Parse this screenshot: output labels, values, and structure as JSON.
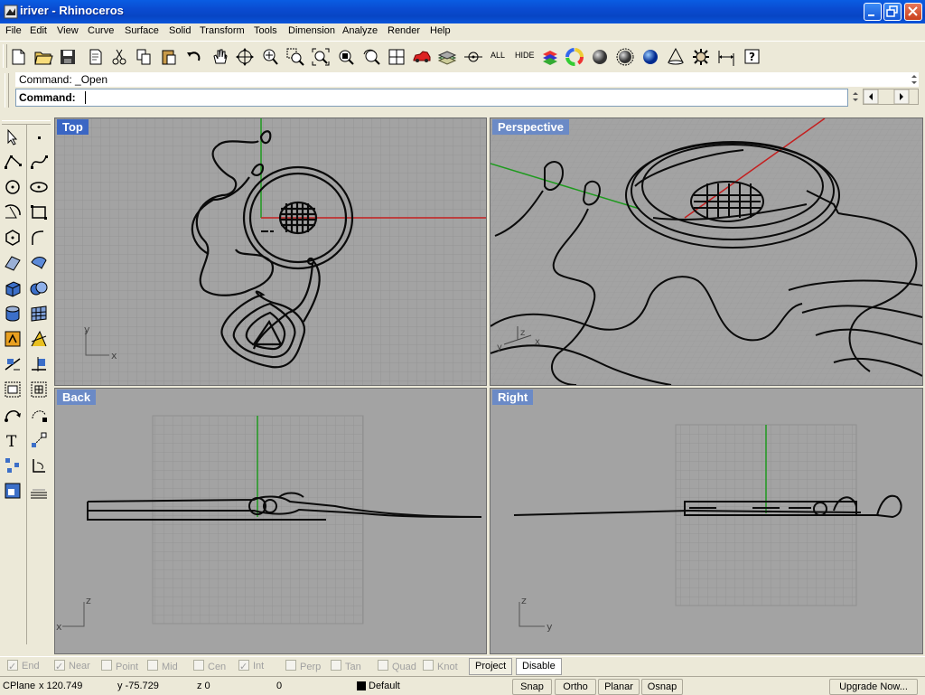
{
  "window": {
    "title": "iriver - Rhinoceros",
    "controls": [
      "minimize-icon",
      "restore-icon",
      "close-icon"
    ]
  },
  "menu": [
    "File",
    "Edit",
    "View",
    "Curve",
    "Surface",
    "Solid",
    "Transform",
    "Tools",
    "Dimension",
    "Analyze",
    "Render",
    "Help"
  ],
  "toolbar": {
    "icons": [
      "new-file-icon",
      "open-file-icon",
      "save-icon",
      "print-icon",
      "cut-icon",
      "copy-icon",
      "paste-icon",
      "undo-icon",
      "pan-icon",
      "rotate-view-icon",
      "zoom-dynamic-icon",
      "zoom-window-icon",
      "zoom-extents-icon",
      "zoom-selected-icon",
      "undo-view-icon",
      "four-viewports-icon",
      "car-icon",
      "layers-icon",
      "snap-icon",
      "show-all-icon",
      "hide-icon",
      "layer-stack-icon",
      "color-wheel-icon",
      "gray-sphere-icon",
      "rendered-sphere-icon",
      "blue-sphere-icon",
      "cone-light-icon",
      "gear-icon",
      "dimension-icon",
      "help-icon"
    ],
    "all_label": "ALL",
    "hide_label": "HIDE"
  },
  "command": {
    "history": "Command: _Open",
    "prompt": "Command:",
    "value": ""
  },
  "left_toolbar": [
    "select-arrow-icon",
    "point-icon",
    "polyline-icon",
    "curve-icon",
    "circle-icon",
    "ellipse-icon",
    "arc-icon",
    "rectangle-icon",
    "polygon-icon",
    "fillet-curve-icon",
    "surface-point-icon",
    "surface-icon",
    "box-icon",
    "sphere-boolean-icon",
    "cylinder-icon",
    "mesh-icon",
    "box-orange-icon",
    "drafting-icon",
    "trim-icon",
    "split-icon",
    "move-icon",
    "array-icon",
    "rotate-icon",
    "scale-icon",
    "text-icon",
    "snap-grid-icon",
    "points-icon",
    "undo-arrow-icon",
    "render-icon",
    "ground-plane-icon"
  ],
  "viewports": [
    {
      "id": "top",
      "title": "Top",
      "axis_a": "y",
      "axis_b": "x"
    },
    {
      "id": "perspective",
      "title": "Perspective",
      "axis_a": "z",
      "axis_b": "x",
      "axis_c": "y"
    },
    {
      "id": "back",
      "title": "Back",
      "axis_a": "z",
      "axis_b": "x"
    },
    {
      "id": "right",
      "title": "Right",
      "axis_a": "z",
      "axis_b": "y"
    }
  ],
  "osnaps": [
    {
      "label": "End",
      "checked": true
    },
    {
      "label": "Near",
      "checked": true
    },
    {
      "label": "Point",
      "checked": false
    },
    {
      "label": "Mid",
      "checked": false
    },
    {
      "label": "Cen",
      "checked": false
    },
    {
      "label": "Int",
      "checked": true
    },
    {
      "label": "Perp",
      "checked": false
    },
    {
      "label": "Tan",
      "checked": false
    },
    {
      "label": "Quad",
      "checked": false
    },
    {
      "label": "Knot",
      "checked": false
    }
  ],
  "osnap_buttons": {
    "project": "Project",
    "disable": "Disable"
  },
  "status": {
    "cplane": "CPlane",
    "x": "x 120.749",
    "y": "y -75.729",
    "z": "z 0",
    "distance": "0",
    "layer": "Default",
    "layer_color": "#000000",
    "snap": "Snap",
    "ortho": "Ortho",
    "planar": "Planar",
    "osnap": "Osnap",
    "upgrade": "Upgrade Now..."
  },
  "colors": {
    "titlebar": "#0a55db",
    "viewport_bg": "#a3a3a3",
    "x_axis": "#c42020",
    "y_axis": "#1e9a1e",
    "active_title": "#3a66c4"
  }
}
